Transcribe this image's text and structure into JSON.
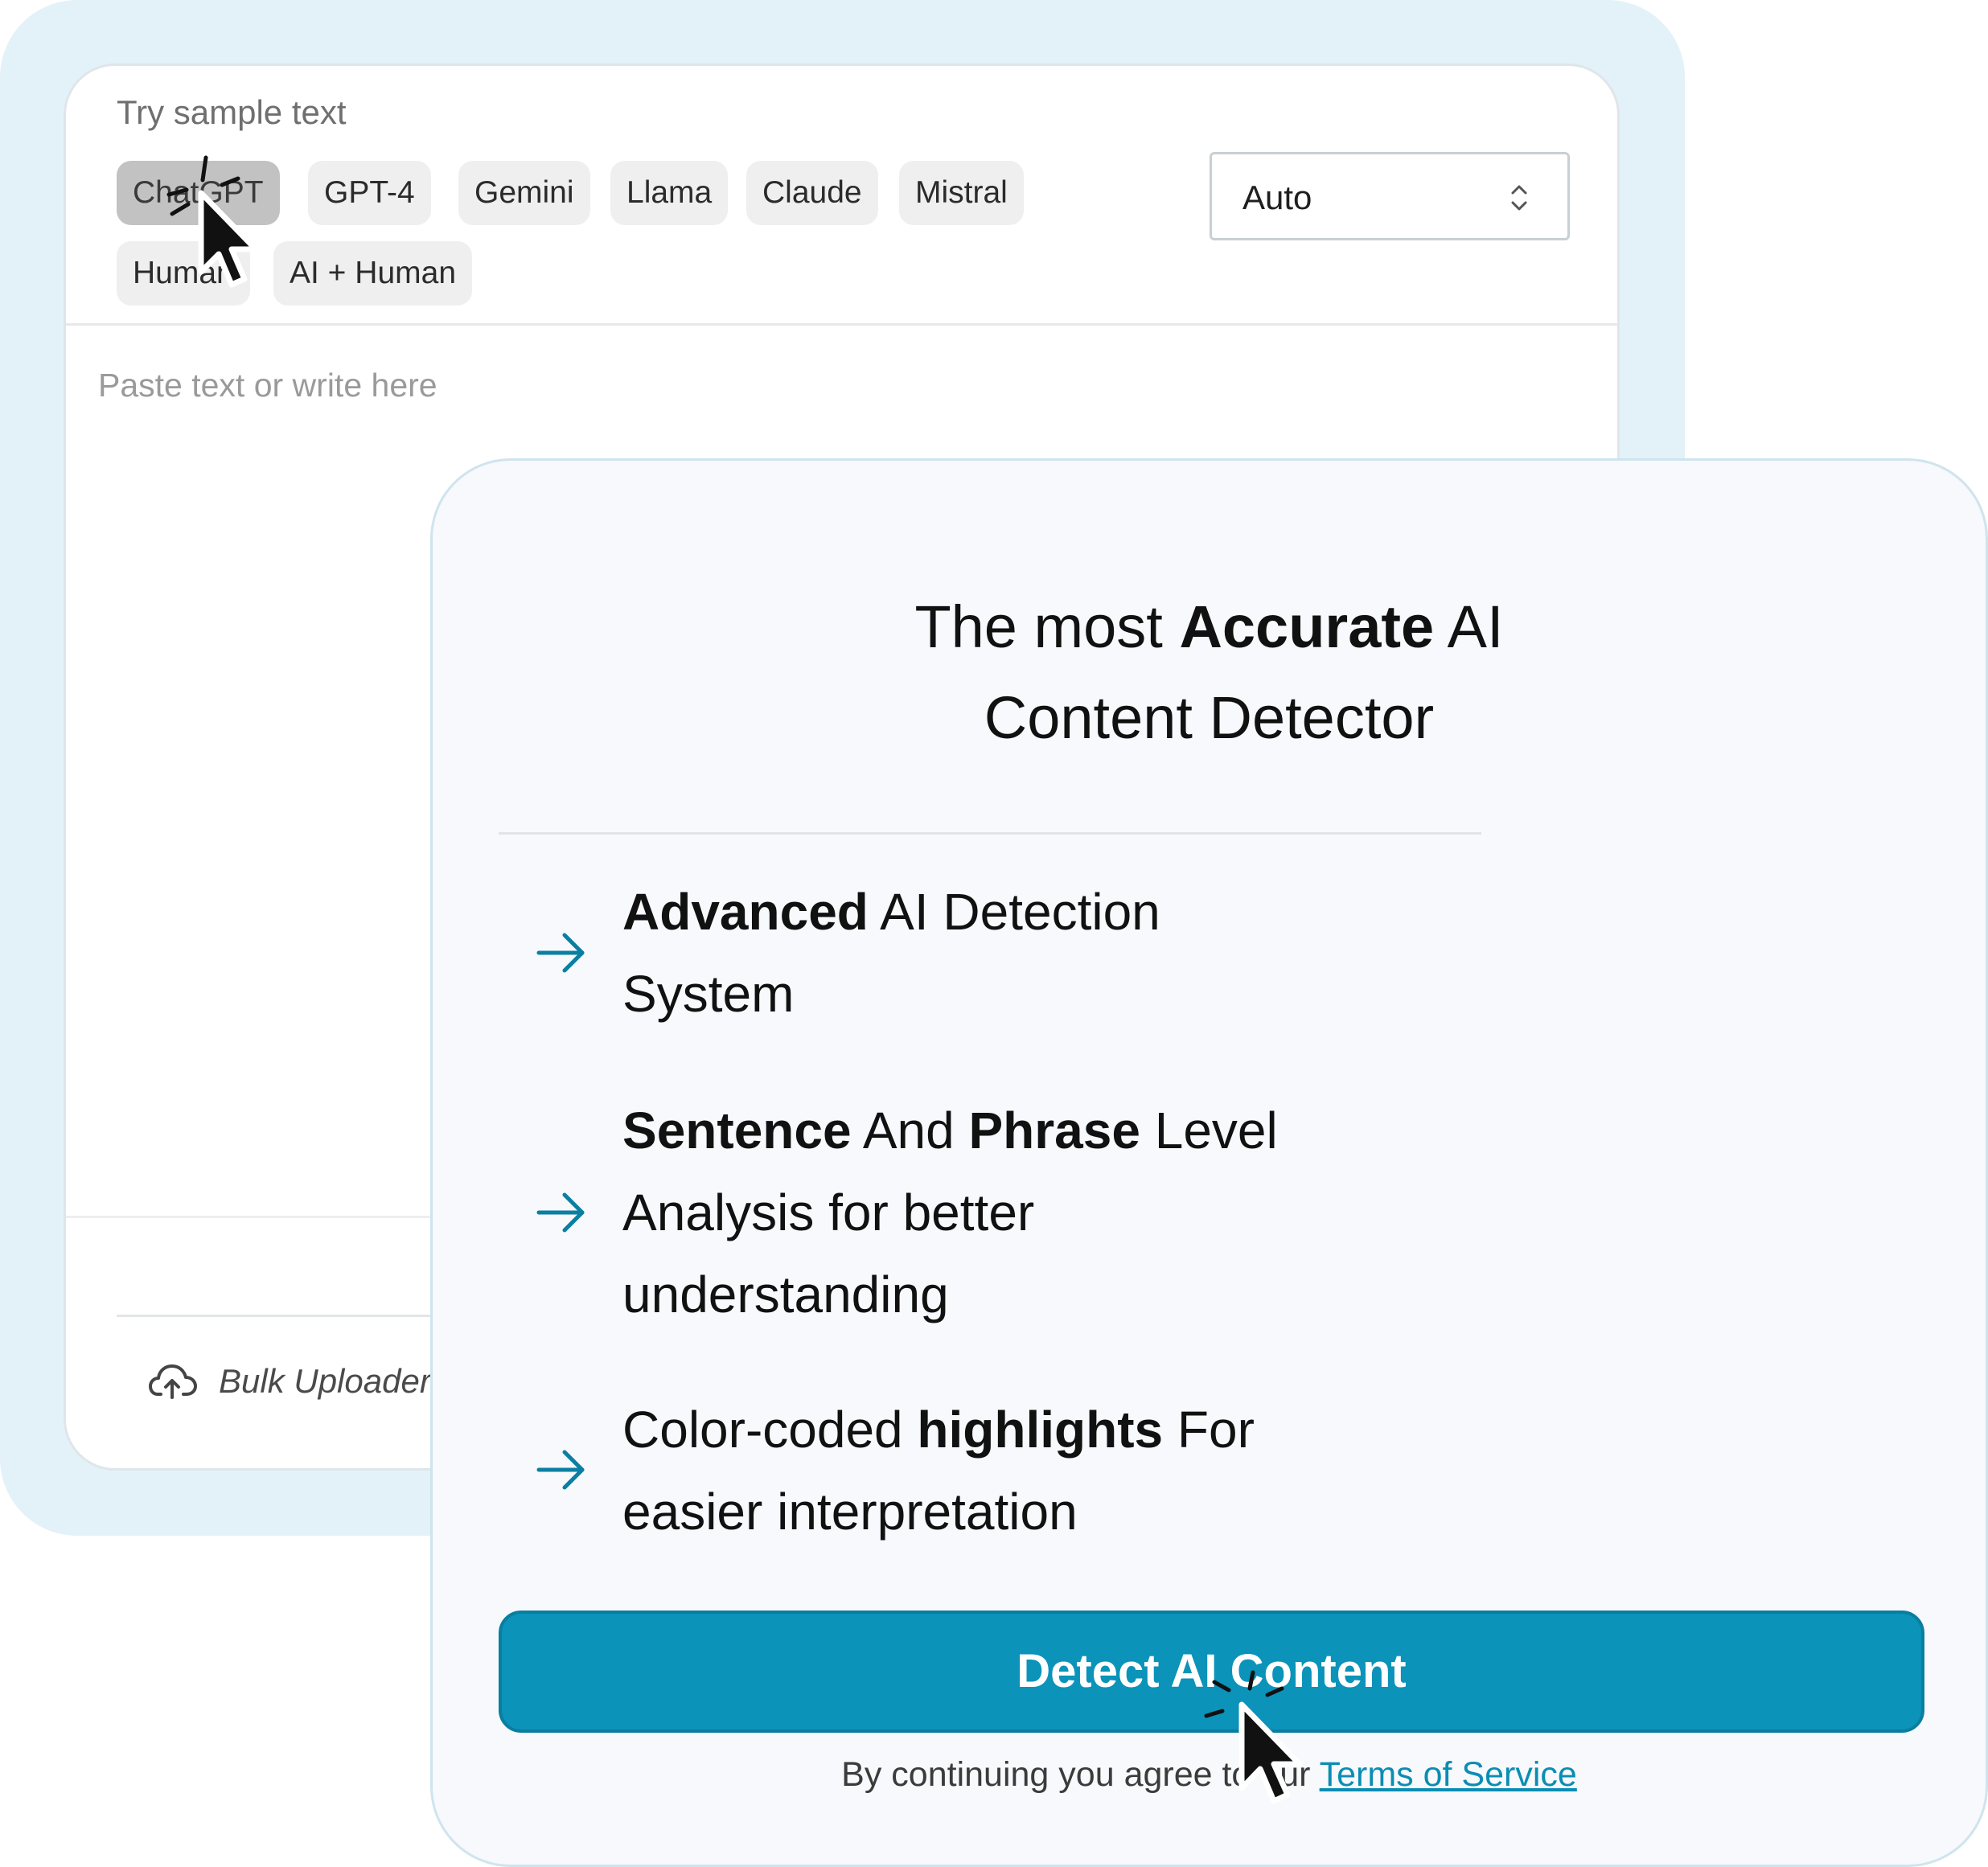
{
  "editor": {
    "sample_label": "Try sample text",
    "chips": [
      "ChatGPT",
      "GPT-4",
      "Gemini",
      "Llama",
      "Claude",
      "Mistral",
      "Human",
      "AI + Human"
    ],
    "model_select_value": "Auto",
    "placeholder": "Paste text or write here",
    "bulk_uploader_label": "Bulk Uploader"
  },
  "promo": {
    "headline": {
      "line1_pre": "The most ",
      "line1_bold": "Accurate",
      "line1_post": " AI",
      "line2": "Content Detector"
    },
    "features": [
      {
        "bold1": "Advanced",
        "text1": " AI Detection",
        "line2": "System"
      },
      {
        "bold1": "Sentence",
        "text1": " And ",
        "bold2": "Phrase",
        "text2": " Level",
        "line2": "Analysis for better",
        "line3": "understanding"
      },
      {
        "text0": "Color-coded ",
        "bold1": "highlights",
        "text1": " For",
        "line2": "easier interpretation"
      }
    ],
    "cta_label": "Detect AI Content",
    "terms_prefix": "By continuing you agree to our ",
    "terms_link": "Terms of Service"
  },
  "colors": {
    "accent": "#0b93b9",
    "frame_bg": "#e3f2f8",
    "arrow": "#0b7fa3"
  },
  "icons": [
    "chevron-up-down-icon",
    "cloud-upload-icon",
    "arrow-right-icon",
    "mouse-pointer-icon"
  ]
}
